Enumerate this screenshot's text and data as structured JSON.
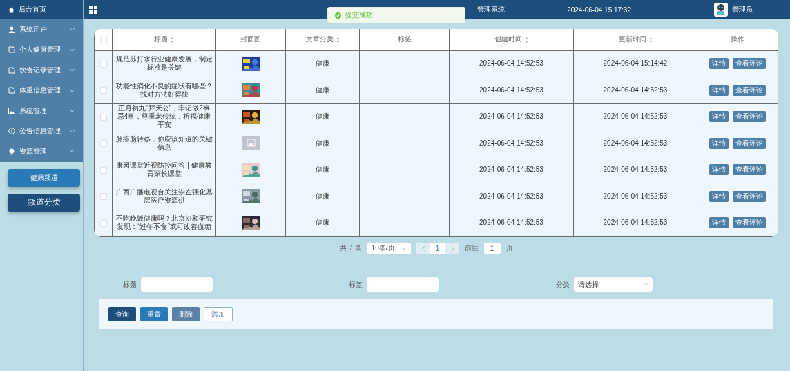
{
  "sidebar": {
    "home": "后台首页",
    "items": [
      {
        "label": "系统用户",
        "expanded": false
      },
      {
        "label": "个人健康管理",
        "expanded": false
      },
      {
        "label": "饮食记录管理",
        "expanded": false
      },
      {
        "label": "体重信息管理",
        "expanded": false
      },
      {
        "label": "系统管理",
        "expanded": false
      },
      {
        "label": "公告信息管理",
        "expanded": false
      },
      {
        "label": "资源管理",
        "expanded": true,
        "children": [
          {
            "label": "健康频道",
            "selected": false
          },
          {
            "label": "频道分类",
            "selected": true
          }
        ]
      }
    ]
  },
  "header": {
    "title": "管理系统",
    "datetime": "2024-06-04 15:17:32",
    "user": "管理员"
  },
  "toast": {
    "message": "提交成功!"
  },
  "table": {
    "all_checked": false,
    "columns": [
      {
        "label": "标题",
        "sortable": true
      },
      {
        "label": "封面图",
        "sortable": false
      },
      {
        "label": "文章分类",
        "sortable": true
      },
      {
        "label": "标签",
        "sortable": false
      },
      {
        "label": "创建时间",
        "sortable": true
      },
      {
        "label": "更新时间",
        "sortable": true
      },
      {
        "label": "操作",
        "sortable": false
      }
    ],
    "rows": [
      {
        "checked": false,
        "title": "规范苏打水行业健康发展，制定标准是关键",
        "cover": {
          "kind": "picture"
        },
        "category": "健康",
        "created": "2024-06-04 14:52:53",
        "updated": "2024-06-04 15:14:42",
        "actions": [
          "详情",
          "查看评论"
        ]
      },
      {
        "checked": false,
        "title": "功能性消化不良的症状有哪些？找对方法好得快",
        "cover": {
          "kind": "picture"
        },
        "category": "健康",
        "created": "2024-06-04 14:52:53",
        "updated": "2024-06-04 14:52:53",
        "actions": [
          "详情",
          "查看评论"
        ]
      },
      {
        "checked": false,
        "title": "正月初九“拜天公”，牢记做2事忌4事，尊重老传统，祈福健康平安",
        "cover": {
          "kind": "picture"
        },
        "category": "健康",
        "created": "2024-06-04 14:52:53",
        "updated": "2024-06-04 14:52:53",
        "actions": [
          "详情",
          "查看评论"
        ]
      },
      {
        "checked": false,
        "title": "肺癌脑转移，你应该知道的关键信息",
        "cover": {
          "kind": "placeholder"
        },
        "category": "健康",
        "created": "2024-06-04 14:52:53",
        "updated": "2024-06-04 14:52:53",
        "actions": [
          "详情",
          "查看评论"
        ]
      },
      {
        "checked": false,
        "title": "康园课堂近视防控问答 | 健康教育家长课堂",
        "cover": {
          "kind": "picture"
        },
        "category": "健康",
        "created": "2024-06-04 14:52:53",
        "updated": "2024-06-04 14:52:53",
        "actions": [
          "详情",
          "查看评论"
        ]
      },
      {
        "checked": false,
        "title": "广西广播电视台关注崇左强化基层医疗资源供",
        "cover": {
          "kind": "picture"
        },
        "category": "健康",
        "created": "2024-06-04 14:52:53",
        "updated": "2024-06-04 14:52:53",
        "actions": [
          "详情",
          "查看评论"
        ]
      },
      {
        "checked": false,
        "title": "不吃晚饭健康吗？北京协和研究发现：“过午不食”或可改善血糖",
        "cover": {
          "kind": "picture"
        },
        "category": "健康",
        "created": "2024-06-04 14:52:53",
        "updated": "2024-06-04 14:52:53",
        "actions": [
          "详情",
          "查看评论"
        ]
      }
    ]
  },
  "pagination": {
    "total": "共 7 条",
    "page_size": "10条/页",
    "page": "1",
    "goto_label": "前往",
    "goto_value": "1",
    "goto_suffix": "页"
  },
  "search": {
    "fields": [
      {
        "label": "标题",
        "kind": "input"
      },
      {
        "label": "标签",
        "kind": "input"
      },
      {
        "label": "分类",
        "kind": "select",
        "placeholder": "请选择"
      }
    ]
  },
  "buttons": [
    {
      "label": "查询",
      "kind": "primary"
    },
    {
      "label": "重置",
      "kind": "secondary"
    },
    {
      "label": "删除",
      "kind": "danger"
    },
    {
      "label": "添加",
      "kind": "outline"
    }
  ]
}
